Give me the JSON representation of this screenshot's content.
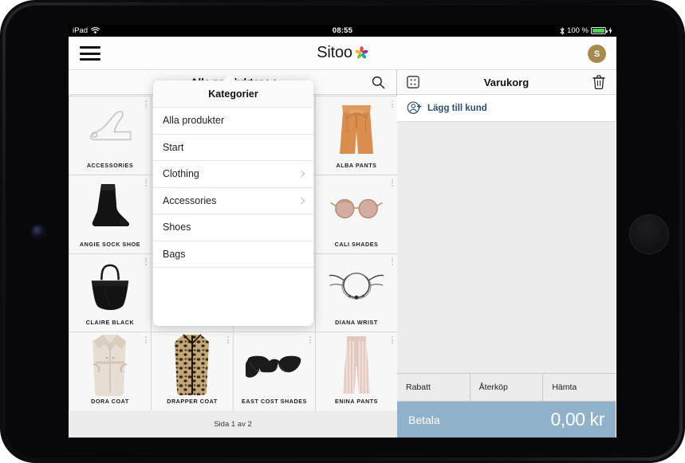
{
  "status_bar": {
    "device": "iPad",
    "wifi_icon": "wifi-icon",
    "time": "08:55",
    "bluetooth_icon": "bluetooth-icon",
    "battery_percent": "100 %",
    "battery_level": 100,
    "charging_icon": "charging-bolt-icon",
    "battery_color": "#4cd44c"
  },
  "app_bar": {
    "menu_icon": "hamburger-menu-icon",
    "logo_text": "Sitoo",
    "logo_mark": "sitoo-pinwheel-icon",
    "avatar_initial": "S",
    "avatar_color": "#a8894e"
  },
  "catalog": {
    "selected": "Alla produkter",
    "dropdown_icon": "chevron-down-icon",
    "search_icon": "search-icon",
    "pager_text": "Sida 1 av 2",
    "menu_icon": "more-vertical-icon",
    "products": [
      {
        "name": "ACCESSORIES",
        "image": "high-heel-shoe-outline-image"
      },
      {
        "name": "",
        "image": ""
      },
      {
        "name": "",
        "image": ""
      },
      {
        "name": "ALBA PANTS",
        "image": "orange-paperbag-pants-image"
      },
      {
        "name": "ANGIE SOCK SHOE",
        "image": "black-ankle-boot-image"
      },
      {
        "name": "",
        "image": ""
      },
      {
        "name": "",
        "image": ""
      },
      {
        "name": "CALI SHADES",
        "image": "round-pink-sunglasses-image"
      },
      {
        "name": "CLAIRE BLACK",
        "image": "black-hobo-handbag-image"
      },
      {
        "name": "",
        "image": ""
      },
      {
        "name": "",
        "image": ""
      },
      {
        "name": "DIANA WRIST",
        "image": "beaded-bracelet-image"
      },
      {
        "name": "DORA COAT",
        "image": "beige-trench-coat-image"
      },
      {
        "name": "DRAPPER COAT",
        "image": "leopard-print-coat-image"
      },
      {
        "name": "EAST COST SHADES",
        "image": "black-cateye-sunglasses-image"
      },
      {
        "name": "ENINA PANTS",
        "image": "pink-striped-pants-image"
      }
    ]
  },
  "categories_popover": {
    "title": "Kategorier",
    "items": [
      {
        "label": "Alla produkter",
        "has_submenu": false
      },
      {
        "label": "Start",
        "has_submenu": false
      },
      {
        "label": "Clothing",
        "has_submenu": true
      },
      {
        "label": "Accessories",
        "has_submenu": true
      },
      {
        "label": "Shoes",
        "has_submenu": false
      },
      {
        "label": "Bags",
        "has_submenu": false
      }
    ]
  },
  "cart": {
    "title": "Varukorg",
    "scan_icon": "scan-barcode-icon",
    "trash_icon": "trash-can-icon",
    "add_customer_label": "Lägg till kund",
    "add_customer_icon": "add-person-icon",
    "add_customer_color": "#2a4f73",
    "actions": [
      {
        "label": "Rabatt"
      },
      {
        "label": "Återköp"
      },
      {
        "label": "Hämta"
      }
    ],
    "pay_label": "Betala",
    "pay_total": "0,00 kr",
    "pay_color": "#8fb1c9"
  }
}
